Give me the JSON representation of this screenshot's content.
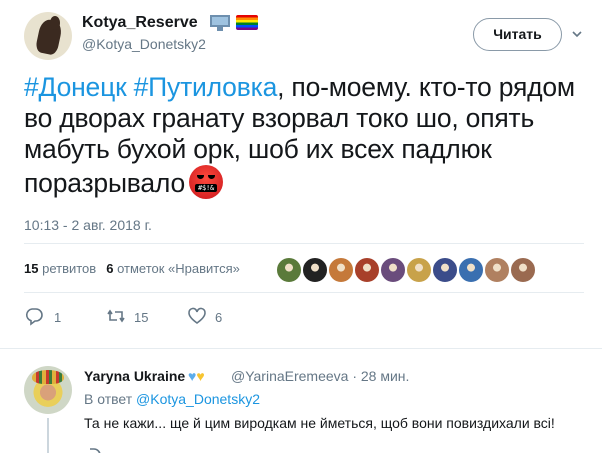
{
  "author": {
    "display_name": "Kotya_Reserve",
    "handle": "@Kotya_Donetsky2",
    "badges": [
      "monitor-icon",
      "rainbow-flag-icon"
    ]
  },
  "follow_button": {
    "label": "Читать"
  },
  "tweet": {
    "hashtag1": "#Донецк",
    "hashtag2": "#Путиловка",
    "text": ", по-моему. кто-то рядом во дворах гранату взорвал токо шо, опять мабуть бухой орк, шоб их всех падлюк поразрывало",
    "emoji": "face-with-symbols-on-mouth-icon",
    "timestamp": "10:13 - 2 авг. 2018 г."
  },
  "stats": {
    "retweets_count": "15",
    "retweets_label": "ретвитов",
    "likes_count": "6",
    "likes_label": "отметок «Нравится»"
  },
  "likers": [
    "#5a7a3a",
    "#222222",
    "#c5793a",
    "#a8402a",
    "#6a4c7c",
    "#c8a24a",
    "#3b4c8a",
    "#3a6fb0",
    "#b08060",
    "#9a6a50"
  ],
  "actions": {
    "reply_count": "1",
    "retweet_count": "15",
    "like_count": "6"
  },
  "reply": {
    "display_name": "Yaryna Ukraine",
    "hearts": [
      "blue",
      "yellow"
    ],
    "handle_time": "@YarinaEremeeva · 28 мин.",
    "reply_prefix": "В ответ",
    "reply_to": "@Kotya_Donetsky2",
    "text": "Та не кажи... ще й цим виродкам не йметься, щоб вони повиздихали всі!"
  },
  "colors": {
    "link": "#1b95e0",
    "secondary_text": "#657786",
    "primary_text": "#14171a"
  }
}
